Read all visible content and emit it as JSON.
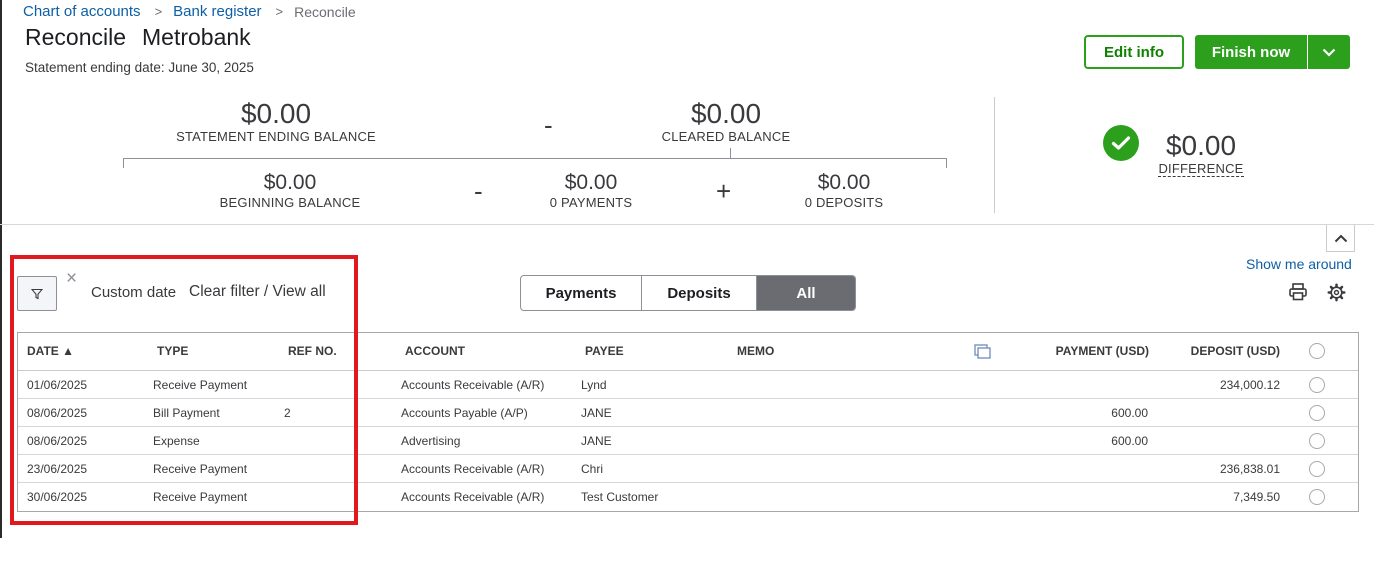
{
  "breadcrumb": {
    "items": [
      "Chart of accounts",
      "Bank register"
    ],
    "separator": ">",
    "current": "Reconcile"
  },
  "header": {
    "title": "Reconcile",
    "account": "Metrobank",
    "statement_date": "Statement ending date: June 30, 2025",
    "edit_label": "Edit info",
    "finish_label": "Finish now"
  },
  "summary": {
    "statement_ending": {
      "value": "$0.00",
      "label": "STATEMENT ENDING BALANCE"
    },
    "cleared": {
      "value": "$0.00",
      "label": "CLEARED BALANCE"
    },
    "beginning": {
      "value": "$0.00",
      "label": "BEGINNING BALANCE"
    },
    "payments": {
      "value": "$0.00",
      "label": "0 PAYMENTS"
    },
    "deposits": {
      "value": "$0.00",
      "label": "0 DEPOSITS"
    },
    "difference": {
      "value": "$0.00",
      "label": "DIFFERENCE"
    },
    "minus_sign": "-",
    "plus_sign": "+"
  },
  "toolbar": {
    "show_me_around": "Show me around",
    "clear_x": "×",
    "custom_date": "Custom date",
    "clear_filter": "Clear filter / View all",
    "tabs": [
      "Payments",
      "Deposits",
      "All"
    ],
    "active_tab": "All"
  },
  "table": {
    "columns": [
      "DATE ▲",
      "TYPE",
      "REF NO.",
      "ACCOUNT",
      "PAYEE",
      "MEMO",
      "PAYMENT (USD)",
      "DEPOSIT (USD)"
    ],
    "rows": [
      {
        "date": "01/06/2025",
        "type": "Receive Payment",
        "ref": "",
        "account": "Accounts Receivable (A/R)",
        "payee": "Lynd",
        "memo": "",
        "payment": "",
        "deposit": "234,000.12"
      },
      {
        "date": "08/06/2025",
        "type": "Bill Payment",
        "ref": "2",
        "account": "Accounts Payable (A/P)",
        "payee": "JANE",
        "memo": "",
        "payment": "600.00",
        "deposit": ""
      },
      {
        "date": "08/06/2025",
        "type": "Expense",
        "ref": "",
        "account": "Advertising",
        "payee": "JANE",
        "memo": "",
        "payment": "600.00",
        "deposit": ""
      },
      {
        "date": "23/06/2025",
        "type": "Receive Payment",
        "ref": "",
        "account": "Accounts Receivable (A/R)",
        "payee": "Chri",
        "memo": "",
        "payment": "",
        "deposit": "236,838.01"
      },
      {
        "date": "30/06/2025",
        "type": "Receive Payment",
        "ref": "",
        "account": "Accounts Receivable (A/R)",
        "payee": "Test Customer",
        "memo": "",
        "payment": "",
        "deposit": "7,349.50"
      }
    ]
  },
  "colors": {
    "brand_green": "#2ca01c",
    "link_blue": "#0d5fa6",
    "highlight_red": "#e0191f",
    "active_tab_bg": "#6b6c72"
  }
}
